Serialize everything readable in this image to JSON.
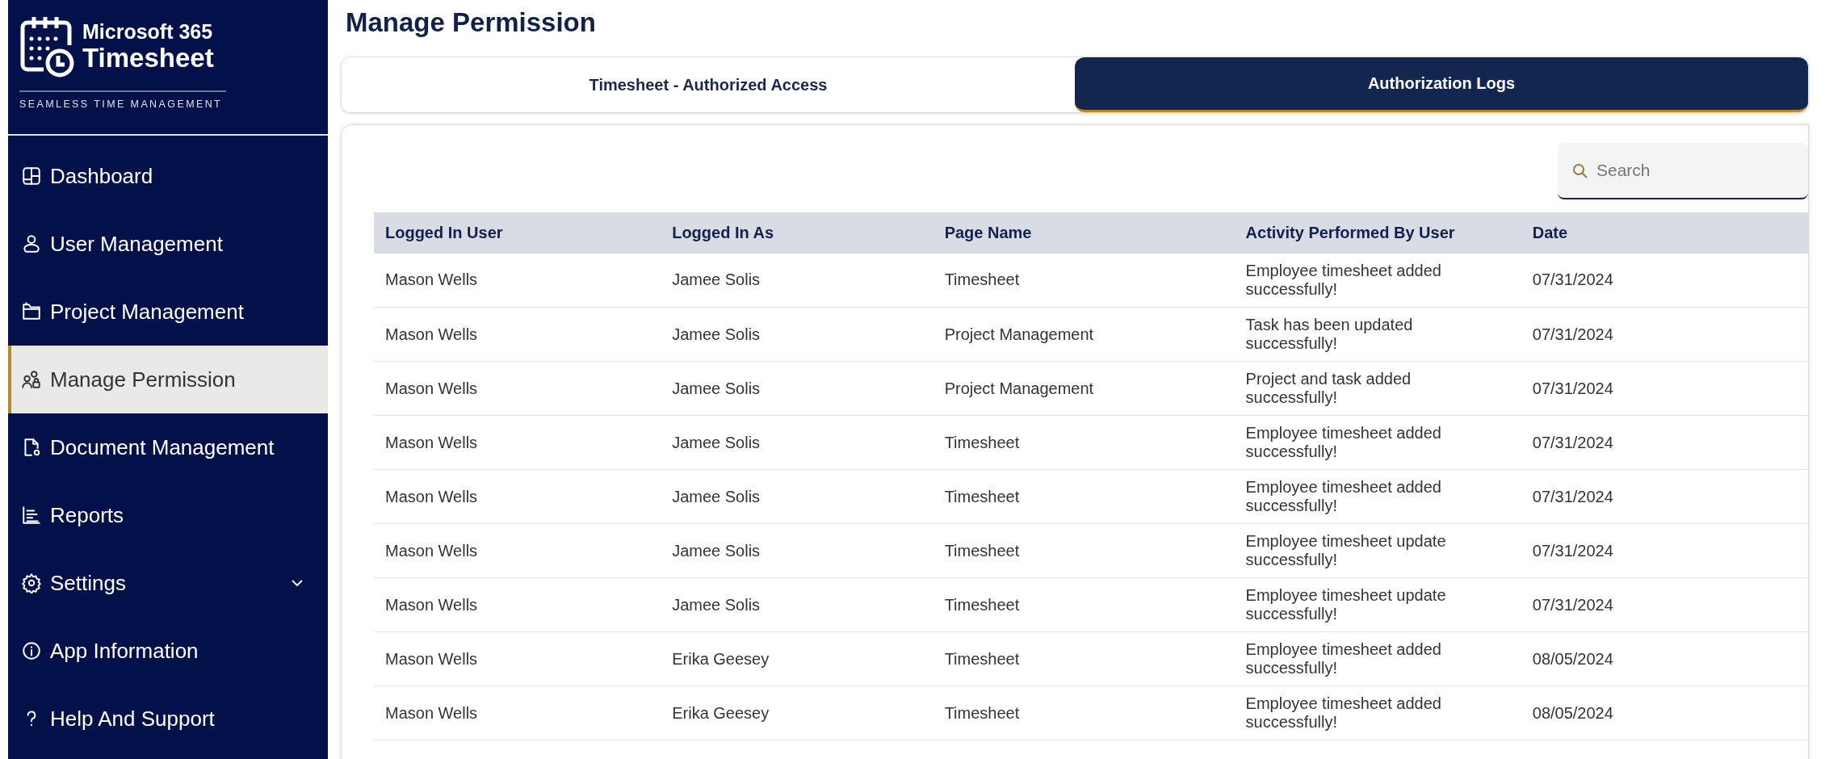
{
  "logo": {
    "line1": "Microsoft 365",
    "line2": "Timesheet",
    "tagline": "SEAMLESS TIME MANAGEMENT"
  },
  "sidebar": {
    "items": [
      {
        "label": "Dashboard",
        "selected": false
      },
      {
        "label": "User Management",
        "selected": false
      },
      {
        "label": "Project Management",
        "selected": false
      },
      {
        "label": "Manage Permission",
        "selected": true
      },
      {
        "label": "Document Management",
        "selected": false
      },
      {
        "label": "Reports",
        "selected": false
      },
      {
        "label": "Settings",
        "selected": false,
        "expandable": true
      },
      {
        "label": "App Information",
        "selected": false
      },
      {
        "label": "Help And Support",
        "selected": false
      }
    ]
  },
  "page_title": "Manage Permission",
  "tabs": [
    {
      "label": "Timesheet - Authorized Access",
      "selected": false
    },
    {
      "label": "Authorization Logs",
      "selected": true
    }
  ],
  "search": {
    "placeholder": "Search"
  },
  "table": {
    "columns": [
      "Logged In User",
      "Logged In As",
      "Page Name",
      "Activity Performed By User",
      "Date"
    ],
    "rows": [
      [
        "Mason Wells",
        "Jamee Solis",
        "Timesheet",
        "Employee timesheet added successfully!",
        "07/31/2024"
      ],
      [
        "Mason Wells",
        "Jamee Solis",
        "Project Management",
        "Task has been updated successfully!",
        "07/31/2024"
      ],
      [
        "Mason Wells",
        "Jamee Solis",
        "Project Management",
        "Project and task added successfully!",
        "07/31/2024"
      ],
      [
        "Mason Wells",
        "Jamee Solis",
        "Timesheet",
        "Employee timesheet added successfully!",
        "07/31/2024"
      ],
      [
        "Mason Wells",
        "Jamee Solis",
        "Timesheet",
        "Employee timesheet added successfully!",
        "07/31/2024"
      ],
      [
        "Mason Wells",
        "Jamee Solis",
        "Timesheet",
        "Employee timesheet update successfully!",
        "07/31/2024"
      ],
      [
        "Mason Wells",
        "Jamee Solis",
        "Timesheet",
        "Employee timesheet update successfully!",
        "07/31/2024"
      ],
      [
        "Mason Wells",
        "Erika Geesey",
        "Timesheet",
        "Employee timesheet added successfully!",
        "08/05/2024"
      ],
      [
        "Mason Wells",
        "Erika Geesey",
        "Timesheet",
        "Employee timesheet added successfully!",
        "08/05/2024"
      ]
    ]
  }
}
